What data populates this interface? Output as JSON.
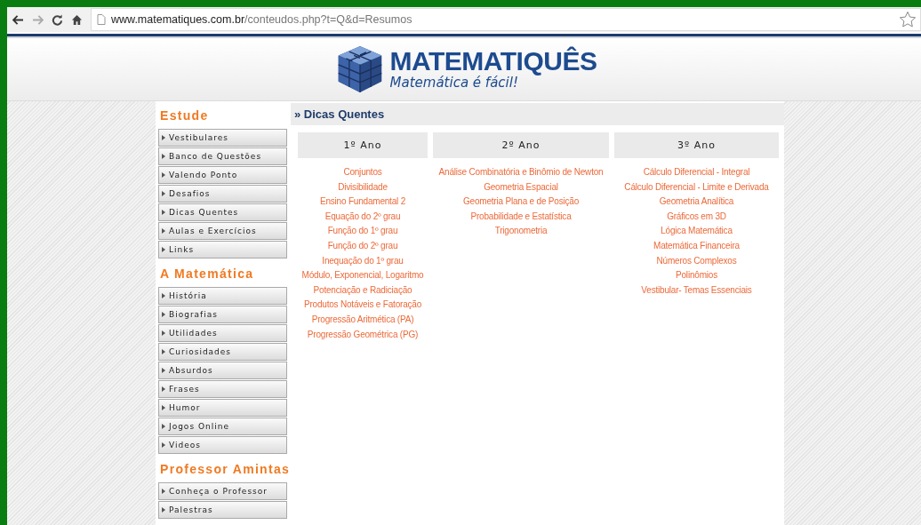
{
  "browser": {
    "url_host": "www.matematiques.com.br",
    "url_path": "/conteudos.php?t=Q&d=Resumos",
    "bookmarked": false
  },
  "header": {
    "title": "MATEMATIQUÊS",
    "tagline": "Matemática é fácil!"
  },
  "sidebar": [
    {
      "heading": "Estude",
      "items": [
        "Vestibulares",
        "Banco de Questões",
        "Valendo Ponto",
        "Desafios",
        "Dicas Quentes",
        "Aulas e Exercícios",
        "Links"
      ]
    },
    {
      "heading": "A Matemática",
      "items": [
        "História",
        "Biografias",
        "Utilidades",
        "Curiosidades",
        "Absurdos",
        "Frases",
        "Humor",
        "Jogos Online",
        "Videos"
      ]
    },
    {
      "heading": "Professor Amintas",
      "items": [
        "Conheça o Professor",
        "Palestras"
      ]
    }
  ],
  "content": {
    "title": "» Dicas Quentes",
    "columns": [
      {
        "heading": "1º Ano",
        "links": [
          "Conjuntos",
          "Divisibilidade",
          "Ensino Fundamental 2",
          "Equação do 2º grau",
          "Função do 1º grau",
          "Função do 2º grau",
          "Inequação do 1º grau",
          "Módulo, Exponencial, Logaritmo",
          "Potenciação e Radiciação",
          "Produtos Notáveis e Fatoração",
          "Progressão Aritmética (PA)",
          "Progressão Geométrica (PG)"
        ]
      },
      {
        "heading": "2º Ano",
        "links": [
          "Análise Combinatória e Binômio de Newton",
          "Geometria Espacial",
          "Geometria Plana e de Posição",
          "Probabilidade e Estatística",
          "Trigonometria"
        ]
      },
      {
        "heading": "3º Ano",
        "links": [
          "Cálculo Diferencial - Integral",
          "Cálculo Diferencial - Limite e Derivada",
          "Geometria Analítica",
          "Gráficos em 3D",
          "Lógica Matemática",
          "Matemática Financeira",
          "Números Complexos",
          "Polinômios",
          "Vestibular- Temas Essenciais"
        ]
      }
    ]
  }
}
